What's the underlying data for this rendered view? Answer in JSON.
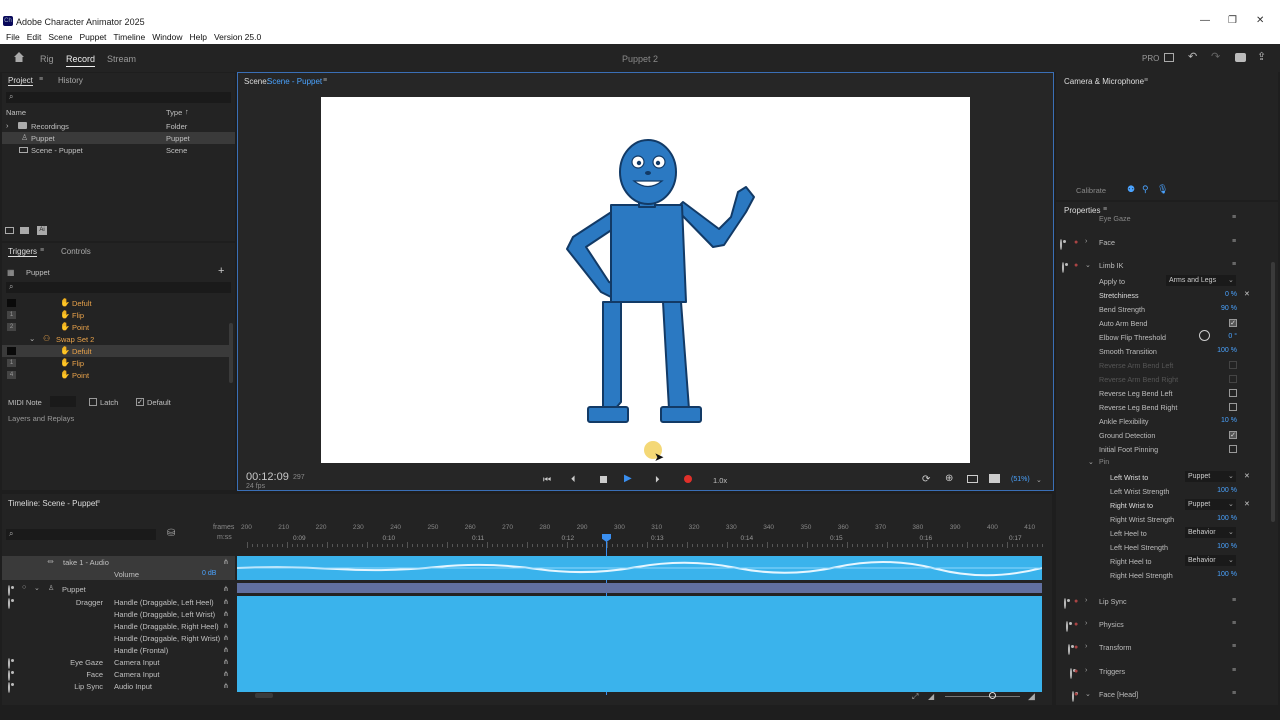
{
  "window": {
    "title": "Adobe Character Animator 2025",
    "app_icon": "Ch",
    "min": "—",
    "max": "❐",
    "close": "✕"
  },
  "menu": [
    "File",
    "Edit",
    "Scene",
    "Puppet",
    "Timeline",
    "Window",
    "Help",
    "Version 25.0"
  ],
  "nav": {
    "tabs": [
      "Rig",
      "Record",
      "Stream"
    ],
    "active": "Record",
    "doc_title": "Puppet 2",
    "pro": "PRO"
  },
  "project": {
    "tabs": [
      "Project",
      "History"
    ],
    "search_placeholder": "",
    "cols": [
      "Name",
      "Type"
    ],
    "sort_arrow": "↑",
    "items": [
      {
        "name": "Recordings",
        "type": "Folder"
      },
      {
        "name": "Puppet",
        "type": "Puppet"
      },
      {
        "name": "Scene - Puppet",
        "type": "Scene"
      }
    ]
  },
  "triggers": {
    "tabs": [
      "Triggers",
      "Controls"
    ],
    "puppet": "Puppet",
    "add": "+",
    "items": [
      {
        "key": "",
        "name": "Defult"
      },
      {
        "key": "1",
        "name": "Flip"
      },
      {
        "key": "2",
        "name": "Point"
      },
      {
        "key": "",
        "name": "Swap Set 2"
      },
      {
        "key": "",
        "name": "Defult"
      },
      {
        "key": "1",
        "name": "Flip"
      },
      {
        "key": "4",
        "name": "Point"
      }
    ],
    "midi_label": "MIDI Note",
    "latch": "Latch",
    "default": "Default",
    "layers_replays": "Layers and Replays"
  },
  "scene": {
    "label": "Scene:",
    "name": "Scene - Puppet",
    "timecode": "00:12:09",
    "frame": "297",
    "fps": "24 fps",
    "speed": "1.0x",
    "zoom": "(51%)"
  },
  "camera": {
    "title": "Camera & Microphone",
    "calibrate": "Calibrate"
  },
  "properties": {
    "title": "Properties",
    "groups": [
      "Eye Gaze",
      "Face",
      "Limb IK",
      "Lip Sync",
      "Physics",
      "Transform",
      "Triggers",
      "Face [Head]"
    ],
    "limb": [
      {
        "name": "Apply to",
        "value": "Arms and Legs"
      },
      {
        "name": "Stretchiness",
        "value": "0 %"
      },
      {
        "name": "Bend Strength",
        "value": "90 %"
      },
      {
        "name": "Auto Arm Bend",
        "value": ""
      },
      {
        "name": "Elbow Flip Threshold",
        "value": "0 °"
      },
      {
        "name": "Smooth Transition",
        "value": "100 %"
      },
      {
        "name": "Reverse Arm Bend Left",
        "value": ""
      },
      {
        "name": "Reverse Arm Bend Right",
        "value": ""
      },
      {
        "name": "Reverse Leg Bend Left",
        "value": ""
      },
      {
        "name": "Reverse Leg Bend Right",
        "value": ""
      },
      {
        "name": "Ankle Flexibility",
        "value": "10 %"
      },
      {
        "name": "Ground Detection",
        "value": ""
      },
      {
        "name": "Initial Foot Pinning",
        "value": ""
      },
      {
        "name": "Pin",
        "value": ""
      },
      {
        "name": "Left Wrist to",
        "value": "Puppet"
      },
      {
        "name": "Left Wrist Strength",
        "value": "100 %"
      },
      {
        "name": "Right Wrist to",
        "value": "Puppet"
      },
      {
        "name": "Right Wrist Strength",
        "value": "100 %"
      },
      {
        "name": "Left Heel to",
        "value": "Behavior"
      },
      {
        "name": "Left Heel Strength",
        "value": "100 %"
      },
      {
        "name": "Right Heel to",
        "value": "Behavior"
      },
      {
        "name": "Right Heel Strength",
        "value": "100 %"
      }
    ]
  },
  "timeline": {
    "title": "Timeline: Scene - Puppet",
    "frames_label": "frames",
    "mss_label": "m:ss",
    "frame_ticks": [
      "200",
      "210",
      "220",
      "230",
      "240",
      "250",
      "260",
      "270",
      "280",
      "290",
      "300",
      "310",
      "320",
      "330",
      "340",
      "350",
      "360",
      "370",
      "380",
      "390",
      "400",
      "410"
    ],
    "sec_ticks": [
      "0:09",
      "0:10",
      "0:11",
      "0:12",
      "0:13",
      "0:14",
      "0:15",
      "0:16",
      "0:17"
    ],
    "tracks": [
      {
        "group": "",
        "name": "take 1 - Audio",
        "value": ""
      },
      {
        "group": "",
        "name": "Volume",
        "value": "0 dB"
      },
      {
        "group": "",
        "name": "Puppet",
        "value": ""
      },
      {
        "group": "Dragger",
        "name": "Handle (Draggable, Left Heel)",
        "value": ""
      },
      {
        "group": "",
        "name": "Handle (Draggable, Left Wrist)",
        "value": ""
      },
      {
        "group": "",
        "name": "Handle (Draggable, Right Heel)",
        "value": ""
      },
      {
        "group": "",
        "name": "Handle (Draggable, Right Wrist)",
        "value": ""
      },
      {
        "group": "",
        "name": "Handle (Frontal)",
        "value": ""
      },
      {
        "group": "Eye Gaze",
        "name": "Camera Input",
        "value": ""
      },
      {
        "group": "Face",
        "name": "Camera Input",
        "value": ""
      },
      {
        "group": "Lip Sync",
        "name": "Audio Input",
        "value": ""
      }
    ]
  }
}
